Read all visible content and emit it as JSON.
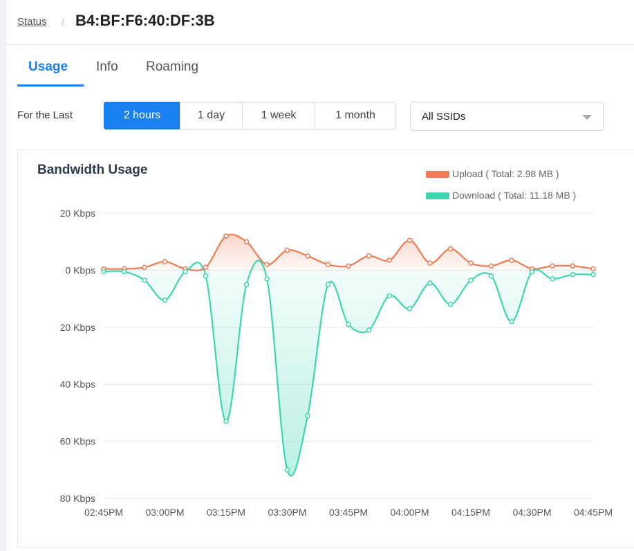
{
  "header": {
    "breadcrumb_link": "Status",
    "breadcrumb_sep": "/",
    "title": "B4:BF:F6:40:DF:3B"
  },
  "tabs": [
    {
      "label": "Usage",
      "active": true
    },
    {
      "label": "Info",
      "active": false
    },
    {
      "label": "Roaming",
      "active": false
    }
  ],
  "filter": {
    "label": "For the Last",
    "periods": [
      {
        "label": "2 hours",
        "active": true
      },
      {
        "label": "1 day",
        "active": false
      },
      {
        "label": "1 week",
        "active": false
      },
      {
        "label": "1 month",
        "active": false
      }
    ],
    "ssid_select": {
      "value": "All SSIDs"
    }
  },
  "colors": {
    "accent": "#1a7ff0",
    "upload": "#f08a63",
    "download": "#3dd6b0"
  },
  "chart_data": {
    "type": "area",
    "title": "Bandwidth Usage",
    "x": [
      "02:45PM",
      "02:50PM",
      "02:55PM",
      "03:00PM",
      "03:05PM",
      "03:10PM",
      "03:15PM",
      "03:20PM",
      "03:25PM",
      "03:30PM",
      "03:35PM",
      "03:40PM",
      "03:45PM",
      "03:50PM",
      "03:55PM",
      "04:00PM",
      "04:05PM",
      "04:10PM",
      "04:15PM",
      "04:20PM",
      "04:25PM",
      "04:30PM",
      "04:35PM",
      "04:40PM",
      "04:45PM"
    ],
    "x_tick_labels": [
      "02:45PM",
      "03:00PM",
      "03:15PM",
      "03:30PM",
      "03:45PM",
      "04:00PM",
      "04:15PM",
      "04:30PM",
      "04:45PM"
    ],
    "y_tick_labels": [
      "20 Kbps",
      "0 Kbps",
      "20 Kbps",
      "40 Kbps",
      "60 Kbps",
      "80 Kbps"
    ],
    "y_ticks": [
      20,
      0,
      -20,
      -40,
      -60,
      -80
    ],
    "ylim": [
      -80,
      20
    ],
    "series": [
      {
        "name": "Upload ( Total: 2.98 MB )",
        "values": [
          0.5,
          0.5,
          1,
          3,
          0.5,
          1,
          12,
          10,
          2,
          7,
          5,
          2,
          1.5,
          5,
          3.5,
          10.5,
          2.5,
          7.5,
          2.5,
          1.5,
          3.5,
          0.5,
          1.5,
          1.5,
          0.5
        ]
      },
      {
        "name": "Download ( Total: 11.18 MB )",
        "values": [
          -0.5,
          -0.5,
          -3.5,
          -10.5,
          -0.5,
          -2,
          -53,
          -5,
          -3,
          -70,
          -51,
          -5,
          -19,
          -21,
          -9,
          -13.5,
          -4.5,
          -12,
          -3.5,
          -2,
          -18,
          -0.5,
          -3,
          -1.5,
          -1.5
        ]
      }
    ],
    "grid": true,
    "legend_position": "top-right"
  }
}
